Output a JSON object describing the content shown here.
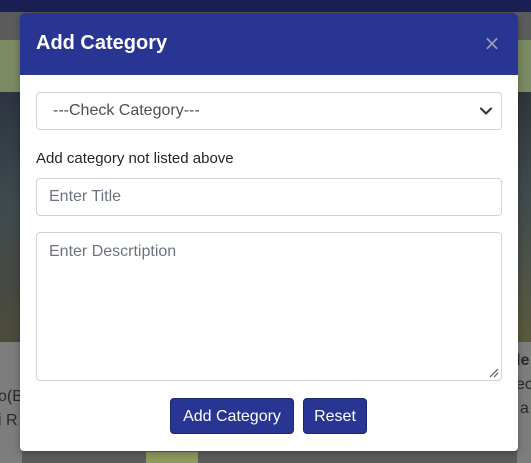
{
  "background": {
    "left_text_1": "o(B",
    "left_text_2": "i R",
    "right_text_1": "le",
    "right_text_2": "ec",
    "right_text_3": "a"
  },
  "modal": {
    "title": "Add Category",
    "close_glyph": "×",
    "category_select": {
      "selected": "---Check Category---"
    },
    "helper_label": "Add category not listed above",
    "title_input": {
      "placeholder": "Enter Title",
      "value": ""
    },
    "description_input": {
      "placeholder": "Enter Descrtiption",
      "value": ""
    },
    "buttons": {
      "add_label": "Add Category",
      "reset_label": "Reset"
    }
  },
  "colors": {
    "header": "#283593",
    "button": "#283593",
    "input_border": "#ced4da",
    "placeholder": "#6c757d"
  },
  "icons": {
    "close": "close-icon",
    "select_arrow": "chevron-down-icon",
    "textarea_resize": "resize-handle-icon"
  }
}
